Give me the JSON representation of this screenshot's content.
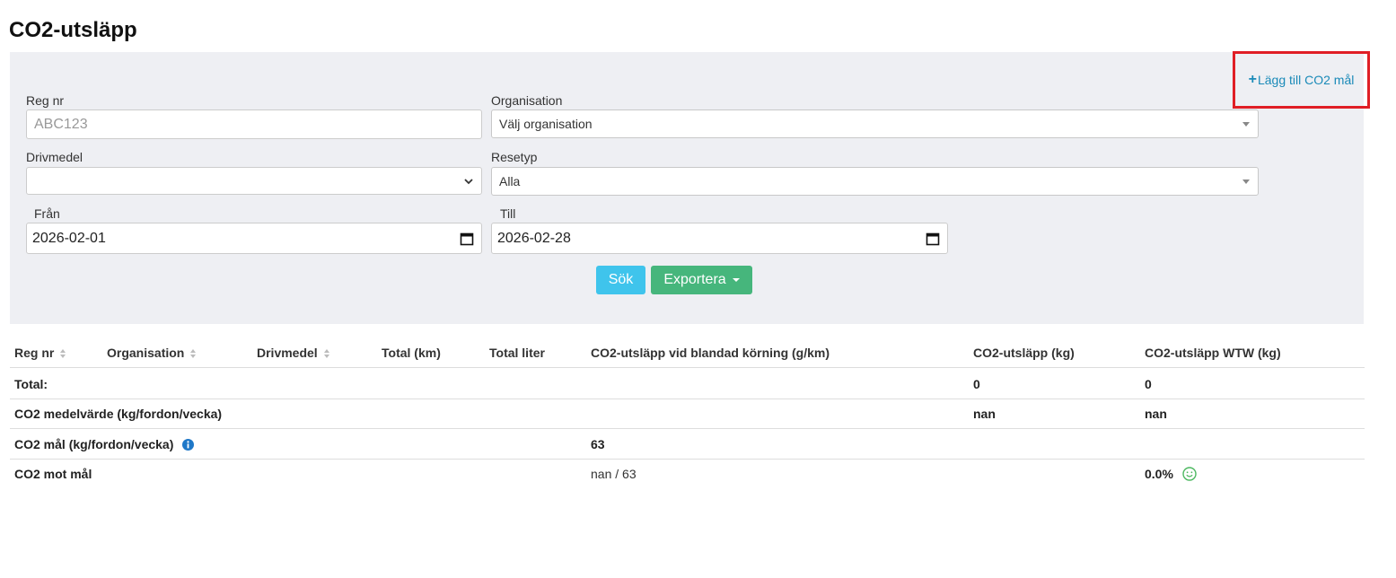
{
  "page": {
    "title": "CO2-utsläpp"
  },
  "actions": {
    "add_goal_label": "Lägg till CO2 mål"
  },
  "filters": {
    "reg_nr": {
      "label": "Reg nr",
      "placeholder": "ABC123",
      "value": ""
    },
    "organisation": {
      "label": "Organisation",
      "value": "Välj organisation"
    },
    "drivmedel": {
      "label": "Drivmedel",
      "value": ""
    },
    "resetyp": {
      "label": "Resetyp",
      "value": "Alla"
    },
    "fran": {
      "label": "Från",
      "value": "2026-02-01"
    },
    "till": {
      "label": "Till",
      "value": "2026-02-28"
    },
    "search_label": "Sök",
    "export_label": "Exportera"
  },
  "table": {
    "headers": [
      "Reg nr",
      "Organisation",
      "Drivmedel",
      "Total (km)",
      "Total liter",
      "CO2-utsläpp vid blandad körning (g/km)",
      "CO2-utsläpp (kg)",
      "CO2-utsläpp WTW (kg)"
    ],
    "rows": {
      "total": {
        "label": "Total:",
        "co2_kg": "0",
        "co2_wtw": "0"
      },
      "avg": {
        "label": "CO2 medelvärde (kg/fordon/vecka)",
        "co2_kg": "nan",
        "co2_wtw": "nan"
      },
      "goal": {
        "label": "CO2 mål (kg/fordon/vecka)",
        "mixed": "63"
      },
      "vs_goal": {
        "label": "CO2 mot mål",
        "mixed": "nan / 63",
        "co2_wtw": "0.0%"
      }
    }
  },
  "colors": {
    "highlight_box": "#e01e25",
    "search_button": "#3fc4ec",
    "export_button": "#46b67c",
    "link": "#1a8ab8"
  }
}
